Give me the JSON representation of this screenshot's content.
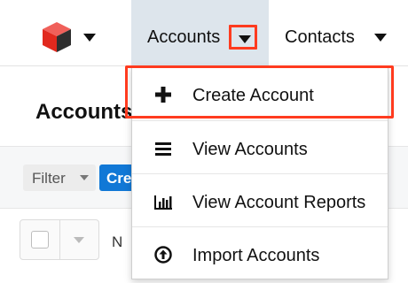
{
  "nav": {
    "logo_icon": "cube-logo-icon",
    "accounts_label": "Accounts",
    "contacts_label": "Contacts"
  },
  "page": {
    "title": "Accounts",
    "filter_label": "Filter",
    "create_label": "Create",
    "column_peek": "N"
  },
  "menu": {
    "items": [
      {
        "label": "Create Account",
        "icon": "plus-icon"
      },
      {
        "label": "View Accounts",
        "icon": "list-icon"
      },
      {
        "label": "View Account Reports",
        "icon": "bar-chart-icon"
      },
      {
        "label": "Import Accounts",
        "icon": "upload-circle-icon"
      }
    ]
  },
  "colors": {
    "highlight": "#ff3b1f",
    "accent": "#1178d6",
    "nav_active_bg": "#dde5ec"
  }
}
